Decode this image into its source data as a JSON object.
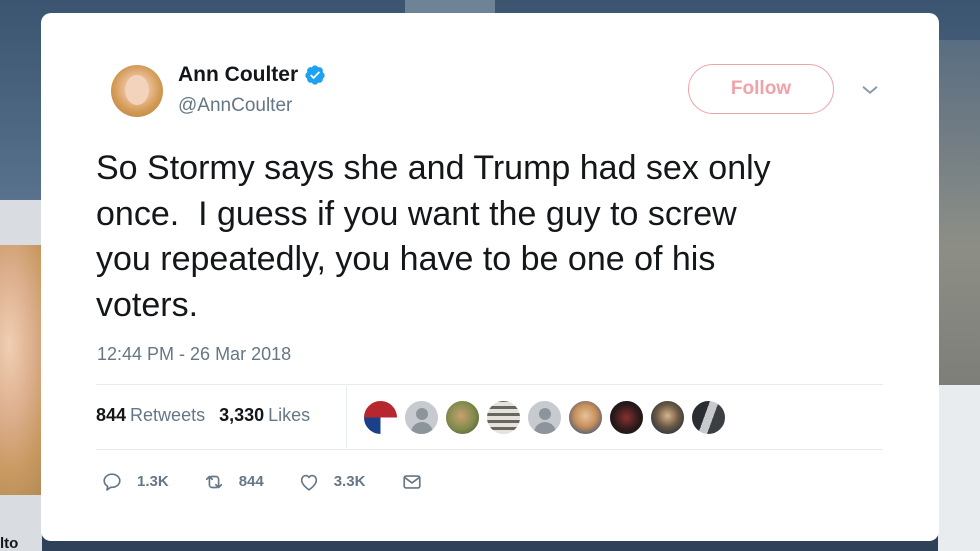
{
  "background": {
    "profile_name_fragment": "lto"
  },
  "tweet": {
    "author": {
      "display_name": "Ann Coulter",
      "handle": "@AnnCoulter",
      "verified": true
    },
    "follow_label": "Follow",
    "text": "So Stormy says she and Trump had sex only\nonce.  I guess if you want the guy to screw\nyou repeatedly, you have to be one of his\nvoters.",
    "timestamp": "12:44 PM - 26 Mar 2018",
    "stats": {
      "retweets_count": "844",
      "retweets_label": "Retweets",
      "likes_count": "3,330",
      "likes_label": "Likes"
    },
    "retweeter_avatars": [
      "flag-avatar",
      "default-avatar",
      "avatar",
      "avatar",
      "default-avatar",
      "avatar",
      "avatar",
      "avatar",
      "avatar"
    ],
    "actions": {
      "replies": "1.3K",
      "retweets": "844",
      "likes": "3.3K"
    }
  },
  "colors": {
    "verified_blue": "#1da1f2",
    "follow_pink": "#f0a2a8",
    "muted_gray": "#657786"
  }
}
